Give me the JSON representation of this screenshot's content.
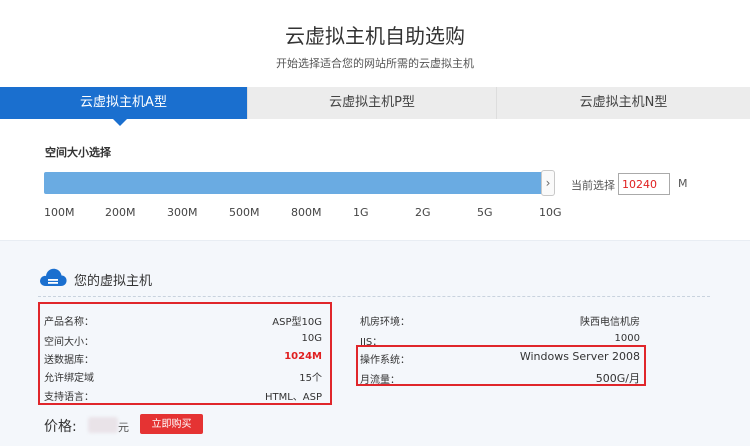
{
  "header": {
    "title": "云虚拟主机自助选购",
    "subtitle": "开始选择适合您的网站所需的云虚拟主机"
  },
  "tabs": [
    {
      "label": "云虚拟主机A型",
      "active": true
    },
    {
      "label": "云虚拟主机P型",
      "active": false
    },
    {
      "label": "云虚拟主机N型",
      "active": false
    }
  ],
  "space": {
    "label": "空间大小选择",
    "ticks": [
      "100M",
      "200M",
      "300M",
      "500M",
      "800M",
      "1G",
      "2G",
      "5G",
      "10G"
    ],
    "handle_glyph": "›",
    "current_label": "当前选择",
    "current_value": "10240",
    "unit": "M"
  },
  "summary": {
    "title": "您的虚拟主机",
    "left_rows": [
      {
        "label": "产品名称：",
        "value": "ASP型10G"
      },
      {
        "label": "空间大小：",
        "value": "10G"
      },
      {
        "label": "送数据库：",
        "value": "1024M"
      },
      {
        "label": "允许绑定域",
        "value": "15个"
      },
      {
        "label": "支持语言：",
        "value": "HTML、ASP"
      }
    ],
    "right_rows": [
      {
        "label": "机房环境：",
        "value": "陕西电信机房"
      },
      {
        "label": "IIS：",
        "value": "1000"
      },
      {
        "label": "操作系统：",
        "value": "Windows Server 2008"
      },
      {
        "label": "月流量：",
        "value": "500G/月"
      }
    ]
  },
  "price": {
    "label": "价格:",
    "unit": "元",
    "buy_label": "立即购买"
  },
  "colors": {
    "accent": "#1a6fcf",
    "slider": "#6aabe2",
    "highlight": "#e0262b",
    "buy": "#e53333"
  }
}
